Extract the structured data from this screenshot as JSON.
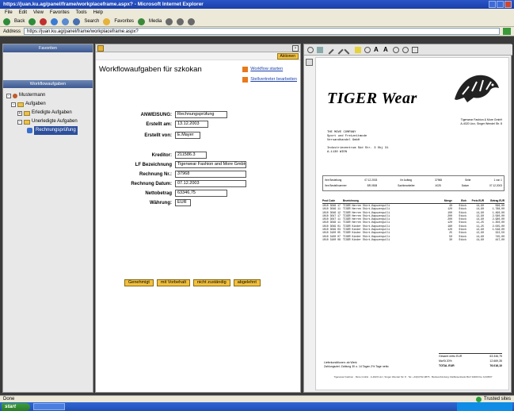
{
  "window": {
    "title": "https://juan.ku.ag/panel/frame/workplaceframe.aspx? - Microsoft Internet Explorer"
  },
  "menu": [
    "File",
    "Edit",
    "View",
    "Favorites",
    "Tools",
    "Help"
  ],
  "toolbar": {
    "back": "Back",
    "search": "Search",
    "favorites": "Favorites",
    "media": "Media"
  },
  "address": {
    "label": "Address",
    "url": "https://juan.ku.ag/panel/frame/workplaceframe.aspx?"
  },
  "left": {
    "header_top": "Favoriten",
    "header": "Workflowaufgaben",
    "tree": {
      "root": "Mustermann",
      "tasks": "Aufgaben",
      "done": "Erledigte Aufgaben",
      "open": "Unerledigte Aufgaben",
      "selected": "Rechnungsprüfung"
    }
  },
  "center": {
    "aktionen": "Aktionen",
    "title": "Workflowaufgaben für szkokan",
    "link_start": "Workflow starten",
    "link_edit": "Stellvertreter bearbeiten",
    "fields": {
      "anweisung_label": "ANWEISUNG:",
      "anweisung": "Rechnungsprüfung",
      "erstellt_am_label": "Erstellt am:",
      "erstellt_am": "13.12.2003",
      "erstellt_von_label": "Erstellt von:",
      "erstellt_von": "E.Mayer",
      "kreditor_label": "Kreditor:",
      "kreditor": "211586.3",
      "lf_label": "LF Bezeichnung",
      "lf": "Tigerwear Fashion and More GmbH",
      "rechnung_nr_label": "Rechnung Nr.:",
      "rechnung_nr": "37968",
      "rechnung_datum_label": "Rechnung Datum:",
      "rechnung_datum": "07.12.2003",
      "netto_label": "Nettobetrag",
      "netto": "63346,75",
      "waehrung_label": "Währung:",
      "waehrung": "EUR"
    },
    "buttons": [
      "Genehmigt",
      "mit Vorbehalt",
      "nicht zuständig",
      "abgelehnt"
    ]
  },
  "invoice": {
    "logo": "TIGER Wear",
    "company": [
      "Tigerwear Fashion & More GmbH",
      "A-4020 Linz, Singer Wendel Str. 8"
    ],
    "recipient": [
      "THE MOVE COMPANY",
      "Sport und Freizeitmode",
      "Versandhandel GmbH",
      "",
      "Industriezentrum Süd Str. 3 Obj 31",
      "A-1130 WIEN"
    ],
    "meta": [
      [
        "Ihre Bestellung",
        "07.12.2003",
        "Ihr Auftrag",
        "37968",
        "Seite",
        "1 von 1"
      ],
      [
        "Ihre Bestellnummer",
        "BR-0508",
        "Sachbearbeiter",
        "4025",
        "Datum",
        "07.12.2003"
      ]
    ],
    "columns": [
      "Prod Code",
      "Bezeichnung",
      "Menge",
      "Einh",
      "Preis EUR",
      "Betrag EUR"
    ],
    "rows": [
      [
        "1010 3046 17",
        "TIGER Herren Shirt-Kapuzenpulli",
        "40",
        "Stück",
        "14,90",
        "596,00"
      ],
      [
        "1010 3046 11",
        "TIGER Herren Shirt-Kapuzenpulli",
        "120",
        "Stück",
        "14,90",
        "1.788,00"
      ],
      [
        "1010 3046 12",
        "TIGER Herren Shirt-Kapuzenpulli",
        "100",
        "Stück",
        "14,90",
        "1.490,00"
      ],
      [
        "1010 3047 17",
        "TIGER Herren Shirt-Kapuzenpulli",
        "200",
        "Stück",
        "12,90",
        "2.580,00"
      ],
      [
        "1010 3047 11",
        "TIGER Herren Shirt-Kapuzenpulli",
        "200",
        "Stück",
        "14,90",
        "2.980,00"
      ],
      [
        "1010 3048 11",
        "TIGER Herren Shirt-Kapuzenpulli",
        "120",
        "Stück",
        "11,25",
        "1.350,00"
      ],
      [
        "1010 3049 01",
        "TIGER Kinder Shirt-Kapuzenpulli",
        "180",
        "Stück",
        "11,25",
        "2.025,00"
      ],
      [
        "1010 3049 03",
        "TIGER Kinder Shirt-Kapuzenpulli",
        "120",
        "Stück",
        "12,90",
        "1.548,00"
      ],
      [
        "1010 3100 05",
        "TIGER Kinder Shirt-Kapuzenpulli",
        "25",
        "Stück",
        "12,90",
        "322,50"
      ],
      [
        "1010 3100 07",
        "TIGER Kinder Shirt-Kapuzenpulli",
        "50",
        "Stück",
        "14,90",
        "745,00"
      ],
      [
        "1010 3100 08",
        "TIGER Kinder Shirt-Kapuzenpulli",
        "30",
        "Stück",
        "14,90",
        "447,00"
      ]
    ],
    "terms_label": "Lieferkonditionen:",
    "terms": "ab Werk",
    "payment_label": "Zahlungsziel:",
    "payment": "Zahlung 30 o. 14 Tagen 2% Tage netto",
    "totals": [
      [
        "Gesamt netto EUR",
        "63.346,75"
      ],
      [
        "MwSt 20%",
        "12.669,35"
      ],
      [
        "TOTAL EUR",
        "76.016,10"
      ]
    ],
    "footer": "Tigerwear Fashion · More GmbH · A-4020 Linz, Singer Wendel Str. 8 · Tel. +43(0)732-9876 · Bankverbindung: Raiffeisenbank BLZ 34000 Kto 1234567"
  },
  "status": {
    "left": "Done",
    "zone": "Trusted sites"
  },
  "taskbar": {
    "start": "start"
  }
}
